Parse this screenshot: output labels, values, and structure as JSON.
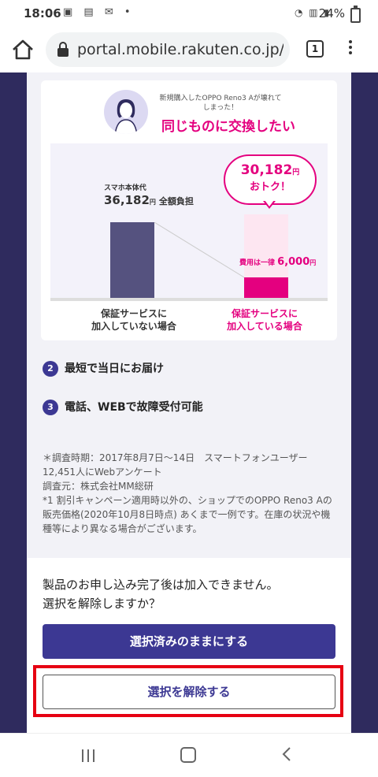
{
  "status": {
    "time": "18:06",
    "battery": "24%"
  },
  "browser": {
    "url": "portal.mobile.rakuten.co.jp/e",
    "tab_count": "1"
  },
  "compare": {
    "subheading": "新規購入したOPPO Reno3 Aが壊れてしまった！",
    "heading": "同じものに交換したい",
    "left_small": "スマホ本体代",
    "left_price": "36,182",
    "left_unit": "円",
    "left_note": "全額負担",
    "bubble_price": "30,182",
    "bubble_unit": "円",
    "bubble_text": "おトク！",
    "fee_label": "費用は一律",
    "fee_amount": "6,000",
    "fee_unit": "円",
    "caption_left_1": "保証サービスに",
    "caption_left_2": "加入していない場合",
    "caption_right_1": "保証サービスに",
    "caption_right_2": "加入している場合",
    "accent_color": "#e4007f"
  },
  "features": [
    {
      "num": "2",
      "text": "最短で当日にお届け"
    },
    {
      "num": "3",
      "text": "電話、WEBで故障受付可能"
    }
  ],
  "notes": [
    "＊調査時期：2017年8月7日〜14日　スマートフォンユーザー12,451人にWebアンケート",
    "調査元：株式会社MM総研",
    "*1 割引キャンペーン適用時以外の、ショップでのOPPO Reno3 Aの販売価格(2020年10月8日時点) あくまで一例です。在庫の状況や機種等により異なる場合がございます。"
  ],
  "confirm": {
    "line1": "製品のお申し込み完了後は加入できません。",
    "line2": "選択を解除しますか？"
  },
  "buttons": {
    "keep": "選択済みのままにする",
    "release": "選択を解除する"
  },
  "colors": {
    "primary": "#3c3893",
    "highlight": "#e60012"
  }
}
